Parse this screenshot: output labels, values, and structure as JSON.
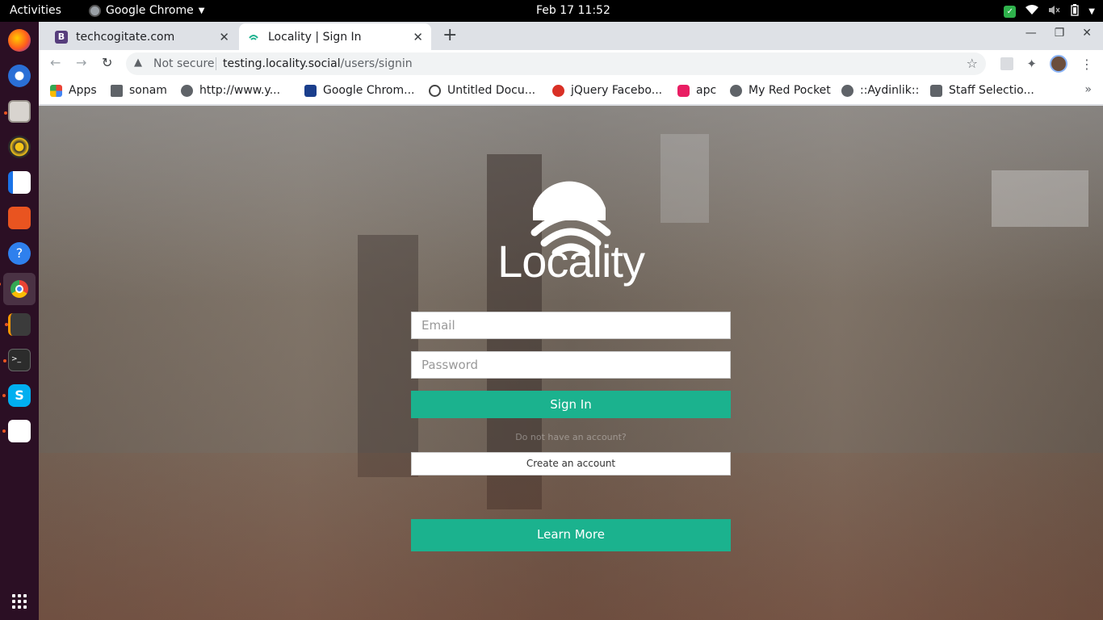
{
  "system": {
    "activities": "Activities",
    "app_name": "Google Chrome",
    "clock": "Feb 17  11:52"
  },
  "dock": {
    "items": [
      "firefox-icon",
      "thunderbird-icon",
      "files-icon",
      "rhythmbox-icon",
      "writer-icon",
      "software-icon",
      "help-icon",
      "chrome-icon",
      "sublime-icon",
      "terminal-icon",
      "skype-icon",
      "text-editor-icon"
    ]
  },
  "browser": {
    "tabs": [
      {
        "title": "techcogitate.com",
        "favicon_color": "#563d7c",
        "favicon_letter": "B"
      },
      {
        "title": "Locality | Sign In",
        "favicon_color": "#1bb28e"
      }
    ],
    "omnibox": {
      "security": "Not secure",
      "host": "testing.locality.social",
      "path": "/users/signin"
    },
    "bookmarks": [
      {
        "label": "Apps",
        "color": "#ea4335"
      },
      {
        "label": "sonam",
        "color": "#5f6368"
      },
      {
        "label": "http://www.y...",
        "color": "#5f6368"
      },
      {
        "label": "Google Chrom...",
        "color": "#1a3e8c"
      },
      {
        "label": "Untitled Docu...",
        "color": "#444"
      },
      {
        "label": "jQuery Facebo...",
        "color": "#d93025"
      },
      {
        "label": "apc",
        "color": "#e91e63"
      },
      {
        "label": "My Red Pocket",
        "color": "#5f6368"
      },
      {
        "label": "::Aydinlik::",
        "color": "#5f6368"
      },
      {
        "label": "Staff Selectio...",
        "color": "#5f6368"
      }
    ]
  },
  "page": {
    "brand": "Locality",
    "email_placeholder": "Email",
    "password_placeholder": "Password",
    "signin_label": "Sign In",
    "no_account_text": "Do not have an account?",
    "create_account_label": "Create an account",
    "learn_more_label": "Learn More",
    "accent_color": "#1bb28e"
  }
}
